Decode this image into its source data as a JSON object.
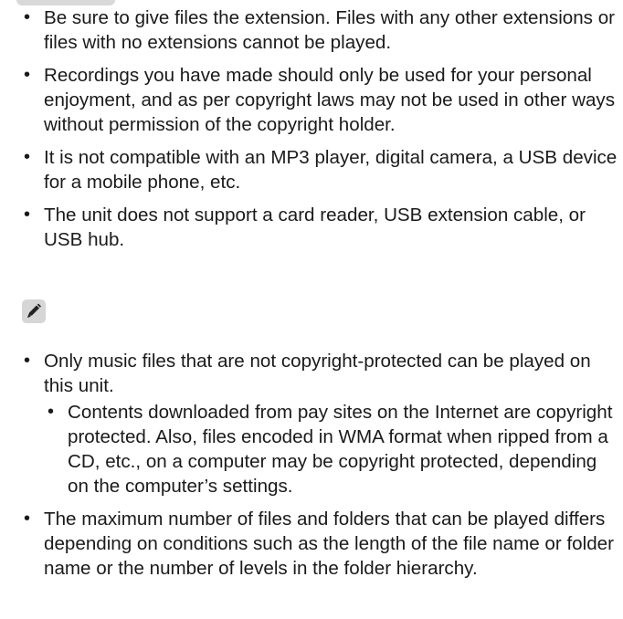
{
  "caution_items": [
    {
      "text": "Be sure to give files the extension. Files with any other extensions or files with no extensions cannot be played."
    },
    {
      "text": "Recordings you have made should only be used for your personal enjoyment, and as per copyright laws may not be used in other ways without permission of the copyright holder."
    },
    {
      "text": "It is not compatible with an MP3 player, digital camera, a USB device for a mobile phone, etc."
    },
    {
      "text": "The unit does not support a card reader, USB extension cable, or USB hub."
    }
  ],
  "note_icon": "pencil-icon",
  "note_items": [
    {
      "text": "Only music files that are not copyright-protected can be played on this unit.",
      "subitems": [
        {
          "text": "Contents downloaded from pay sites on the Internet are copyright protected. Also, files encoded in WMA format when ripped from a CD, etc., on a computer may be copyright protected, depending on the computer’s settings."
        }
      ]
    },
    {
      "text": "The maximum number of files and folders that can be played differs depending on conditions such as the length of the file name or folder name or the number of levels in the folder hierarchy."
    }
  ]
}
